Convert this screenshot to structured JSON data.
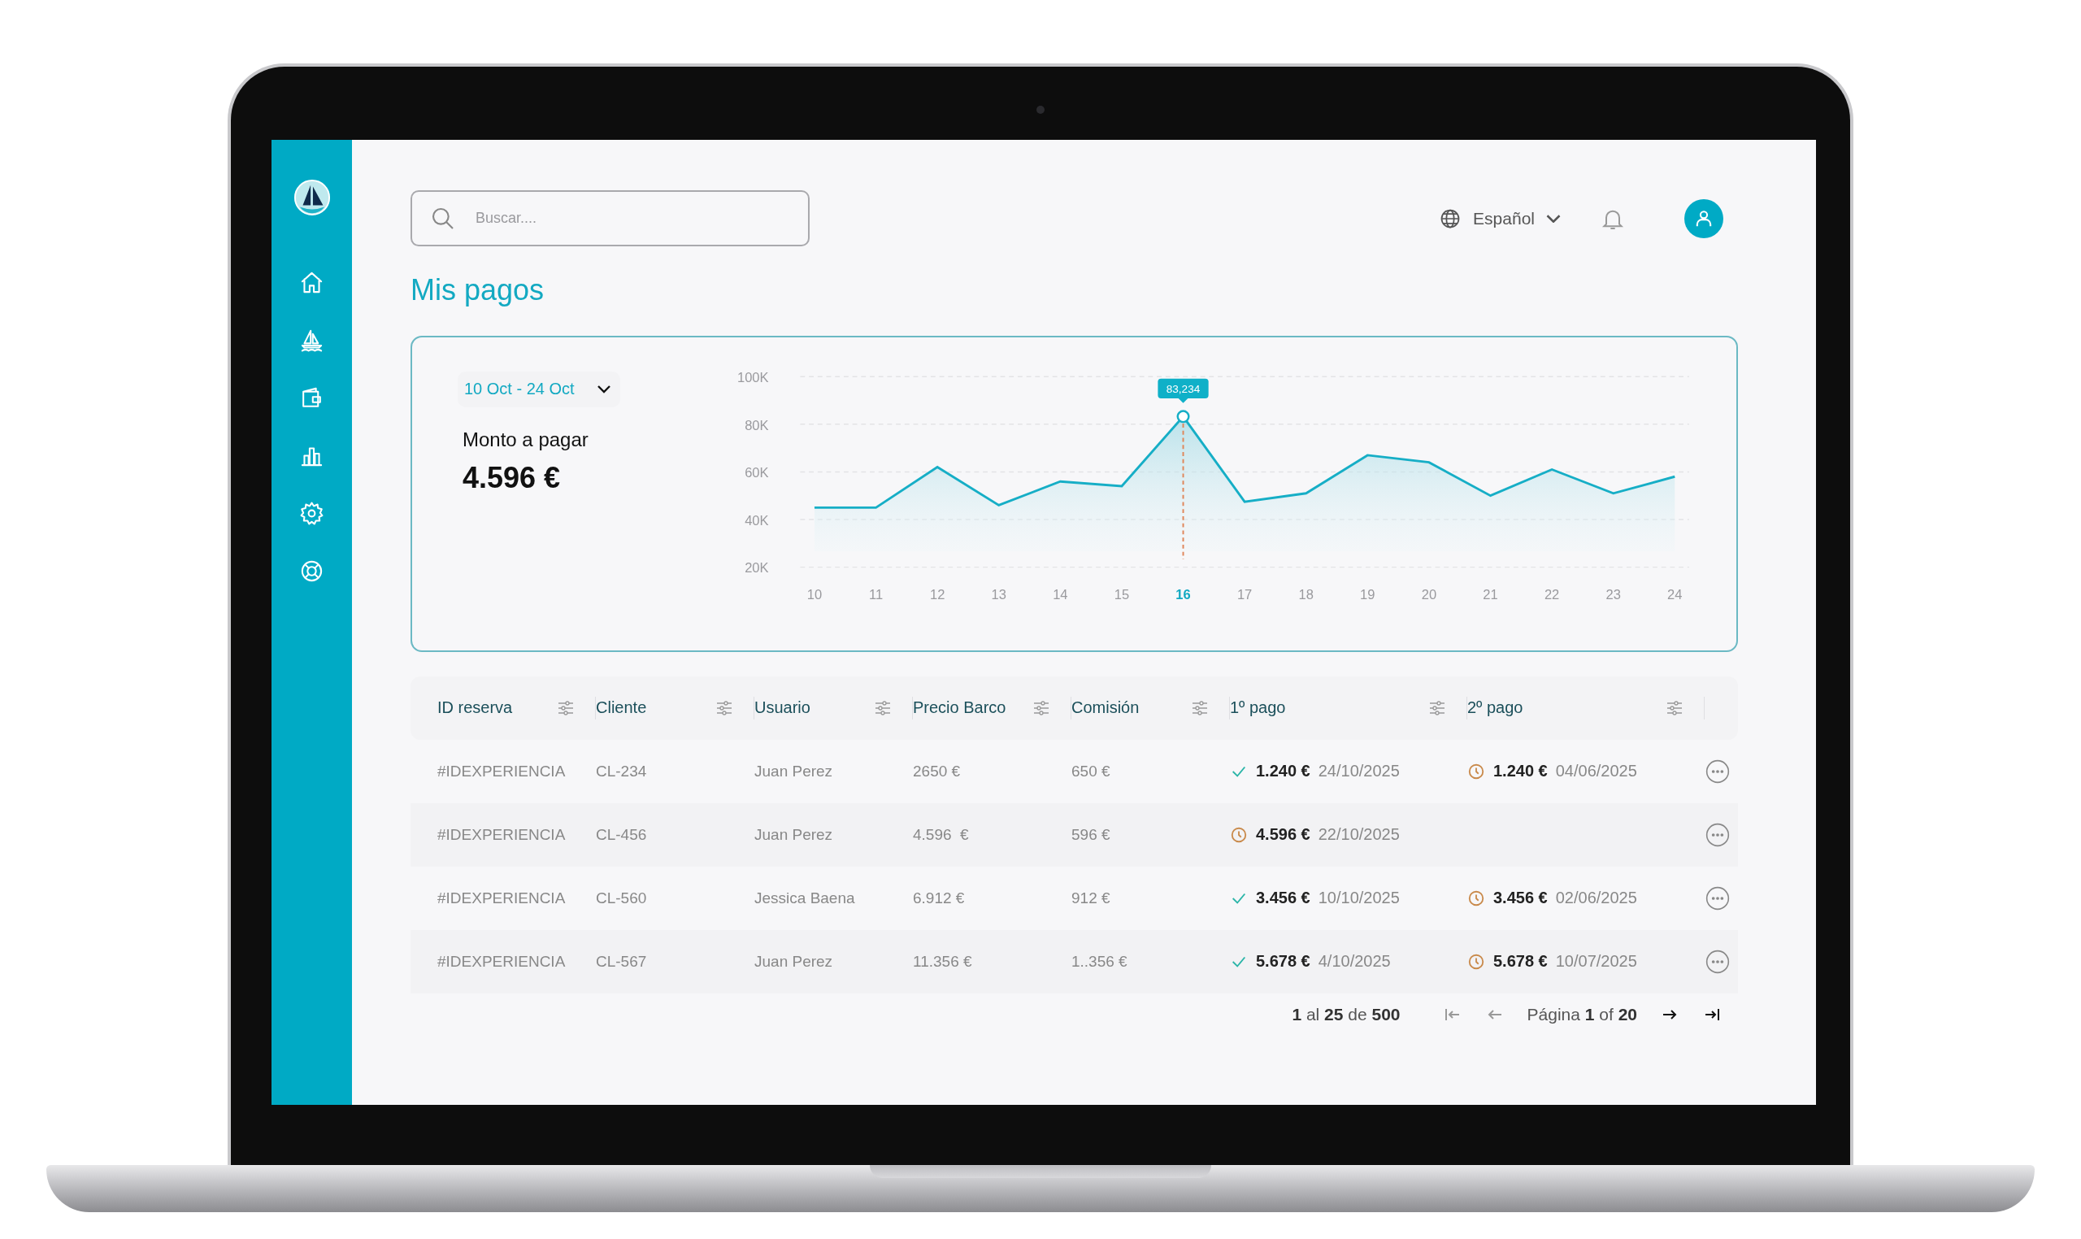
{
  "search": {
    "placeholder": "Buscar...."
  },
  "language": {
    "label": "Español"
  },
  "title": "Mis pagos",
  "summary_card": {
    "date_range": "10 Oct - 24 Oct",
    "label": "Monto a pagar",
    "amount": "4.596 €",
    "chart_data": {
      "type": "area",
      "grid": true,
      "categories": [
        "10",
        "11",
        "12",
        "13",
        "14",
        "15",
        "16",
        "17",
        "18",
        "19",
        "20",
        "21",
        "22",
        "23",
        "24"
      ],
      "values": [
        45000,
        45000,
        62000,
        46000,
        56000,
        54000,
        83234,
        47500,
        51000,
        67000,
        64000,
        50000,
        61000,
        51000,
        58000
      ],
      "ylim": [
        20000,
        100000
      ],
      "yticks": [
        {
          "value": 20000,
          "label": "20K"
        },
        {
          "value": 40000,
          "label": "40K"
        },
        {
          "value": 60000,
          "label": "60K"
        },
        {
          "value": 80000,
          "label": "80K"
        },
        {
          "value": 100000,
          "label": "100K"
        }
      ],
      "ref_lines": [
        {
          "axis": "x",
          "value": "16"
        }
      ],
      "annotations": [
        {
          "x": "16",
          "y": 83234,
          "text": "83,234"
        }
      ]
    }
  },
  "table": {
    "columns": [
      "ID reserva",
      "Cliente",
      "Usuario",
      "Precio Barco",
      "Comisión",
      "1º pago",
      "2º pago"
    ],
    "rows": [
      {
        "id": "#IDEXPERIENCIA",
        "client": "CL-234",
        "user": "Juan Perez",
        "price": "2650 €",
        "commission": "650 €",
        "payments": [
          {
            "kind": "paid",
            "amount": "1.240 €",
            "date": "24/10/2025"
          },
          {
            "kind": "pending",
            "amount": "1.240 €",
            "date": "04/06/2025"
          }
        ]
      },
      {
        "id": "#IDEXPERIENCIA",
        "client": "CL-456",
        "user": "Juan Perez",
        "price": "4.596  €",
        "commission": "596 €",
        "payments": [
          {
            "kind": "pending",
            "amount": "4.596 €",
            "date": "22/10/2025"
          }
        ]
      },
      {
        "id": "#IDEXPERIENCIA",
        "client": "CL-560",
        "user": "Jessica Baena",
        "price": "6.912 €",
        "commission": "912 €",
        "payments": [
          {
            "kind": "paid",
            "amount": "3.456 €",
            "date": "10/10/2025"
          },
          {
            "kind": "pending",
            "amount": "3.456 €",
            "date": "02/06/2025"
          }
        ]
      },
      {
        "id": "#IDEXPERIENCIA",
        "client": "CL-567",
        "user": "Juan Perez",
        "price": "11.356 €",
        "commission": "1..356 €",
        "payments": [
          {
            "kind": "paid",
            "amount": "5.678 €",
            "date": "4/10/2025"
          },
          {
            "kind": "pending",
            "amount": "5.678 €",
            "date": "10/07/2025"
          }
        ]
      }
    ]
  },
  "pagination": {
    "range": "**1** al **25** de **500**",
    "page": "Página **1** of **20**"
  }
}
